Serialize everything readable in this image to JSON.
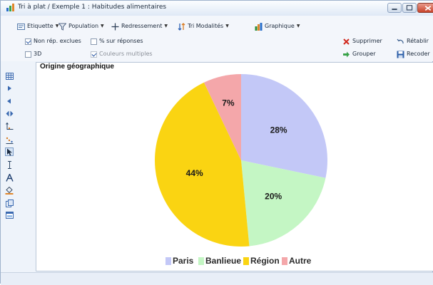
{
  "window": {
    "title": "Tri à plat / Exemple 1 : Habitudes alimentaires"
  },
  "toolbar": {
    "etiquette": "Etiquette",
    "population": "Population",
    "redressement": "Redressement",
    "tri_modalites": "Tri Modalités",
    "graphique": "Graphique",
    "non_rep_exclues": "Non rép. exclues",
    "pct_sur_reponses": "% sur réponses",
    "three_d": "3D",
    "couleurs_multiples": "Couleurs multiples",
    "supprimer": "Supprimer",
    "retablir": "Rétablir",
    "grouper": "Grouper",
    "recoder": "Recoder",
    "checks": {
      "non_rep_exclues": true,
      "pct_sur_reponses": false,
      "three_d": false,
      "couleurs_multiples": true
    }
  },
  "colors": {
    "paris": "#c3c8f7",
    "banlieue": "#c4f6c4",
    "region": "#fad412",
    "autre": "#f4a7aa"
  },
  "chart_data": {
    "type": "pie",
    "title": "Origine géographique",
    "categories": [
      "Paris",
      "Banlieue",
      "Région",
      "Autre"
    ],
    "values": [
      28,
      20,
      44,
      7
    ],
    "labels": [
      "28%",
      "20%",
      "44%",
      "7%"
    ],
    "legend_position": "bottom"
  }
}
